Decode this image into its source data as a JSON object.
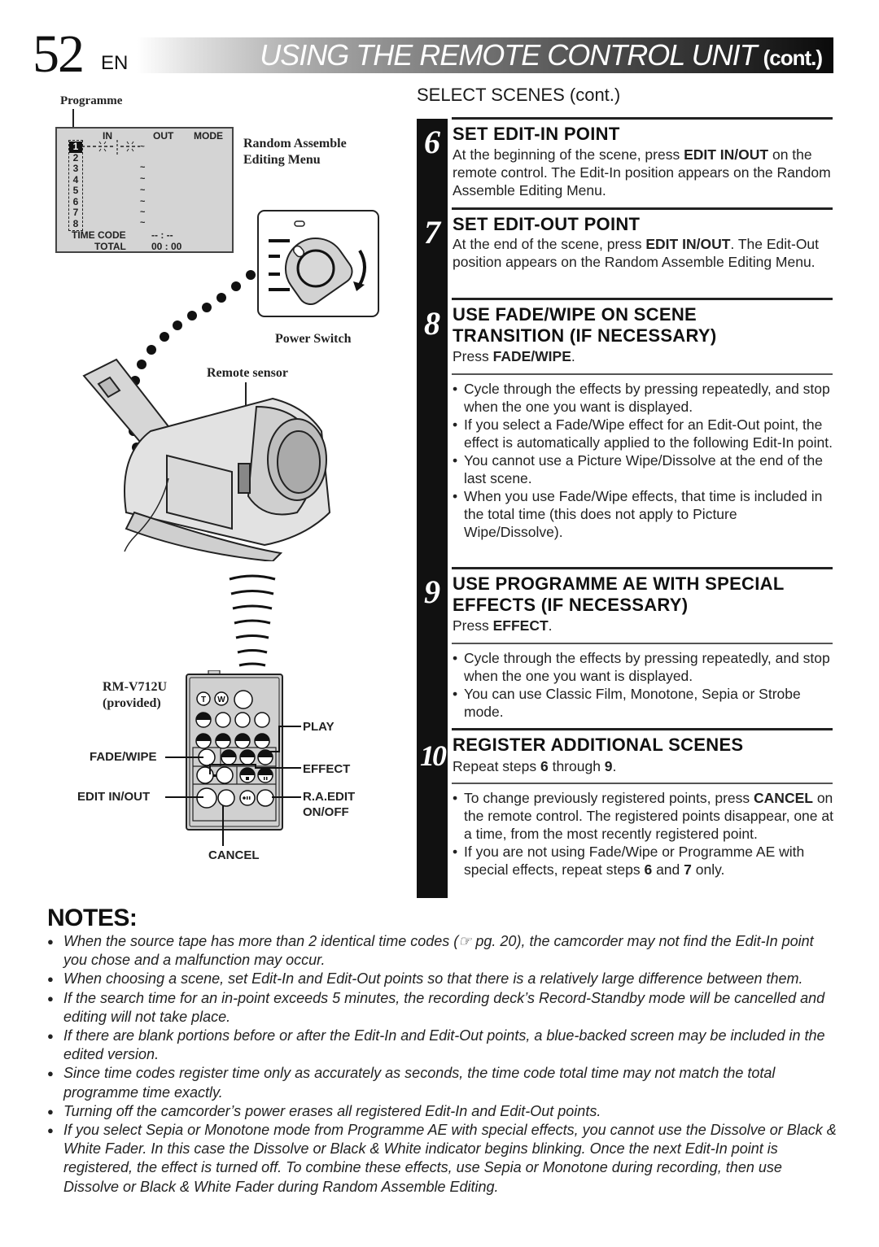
{
  "header": {
    "page_number": "52",
    "language": "EN",
    "title": "USING THE REMOTE CONTROL UNIT",
    "title_suffix": "(cont.)"
  },
  "illustration": {
    "programme_label": "Programme",
    "menu_caption_line1": "Random Assemble",
    "menu_caption_line2": "Editing Menu",
    "menu": {
      "col_in": "IN",
      "col_out": "OUT",
      "col_mode": "MODE",
      "rows": [
        "1",
        "2",
        "3",
        "4",
        "5",
        "6",
        "7",
        "8"
      ],
      "time_code_label": "TIME CODE",
      "time_code_value": "-- : --",
      "total_label": "TOTAL",
      "total_value": "00 : 00"
    },
    "power_switch_label": "Power Switch",
    "remote_sensor_label": "Remote sensor",
    "remote_model": "RM-V712U",
    "remote_model_note": "(provided)",
    "remote_button_T": "T",
    "remote_button_W": "W",
    "callouts": {
      "play": "PLAY",
      "fade_wipe": "FADE/WIPE",
      "effect": "EFFECT",
      "edit_in_out": "EDIT IN/OUT",
      "ra_edit_line1": "R.A.EDIT",
      "ra_edit_line2": "ON/OFF",
      "cancel": "CANCEL"
    }
  },
  "section": {
    "title": "SELECT SCENES (cont.)",
    "steps": [
      {
        "number": "6",
        "heading": "SET EDIT-IN POINT",
        "body_pre": "At the beginning of the scene, press ",
        "body_bold": "EDIT IN/OUT",
        "body_post": " on the remote control. The Edit-In position appears on the Random Assemble Editing Menu."
      },
      {
        "number": "7",
        "heading": "SET EDIT-OUT POINT",
        "body_pre": "At the end of the scene, press ",
        "body_bold": "EDIT IN/OUT",
        "body_post": ". The Edit-Out position appears on the Random Assemble Editing Menu."
      },
      {
        "number": "8",
        "heading_line1": "USE FADE/WIPE ON SCENE",
        "heading_line2": "TRANSITION (IF NECESSARY)",
        "body_pre": "Press ",
        "body_bold": "FADE/WIPE",
        "body_post": ".",
        "bullets": [
          "Cycle through the effects by pressing repeatedly, and stop when the one you want is displayed.",
          "If you select a Fade/Wipe effect for an Edit-Out point, the effect is automatically applied to the following Edit-In point.",
          "You cannot use a Picture Wipe/Dissolve at the end of the last scene.",
          "When you use Fade/Wipe effects, that time is included in the total time (this does not apply to Picture Wipe/Dissolve)."
        ]
      },
      {
        "number": "9",
        "heading_line1": "USE PROGRAMME AE WITH SPECIAL",
        "heading_line2": "EFFECTS (IF NECESSARY)",
        "body_pre": "Press ",
        "body_bold": "EFFECT",
        "body_post": ".",
        "bullets": [
          "Cycle through the effects by pressing repeatedly, and stop when the one you want is displayed.",
          "You can use Classic Film, Monotone, Sepia or Strobe mode."
        ]
      },
      {
        "number": "10",
        "heading": "REGISTER ADDITIONAL SCENES",
        "body_pre": "Repeat steps ",
        "body_bold1": "6",
        "body_mid": " through ",
        "body_bold2": "9",
        "body_post": ".",
        "bullet1_pre": "To change previously registered points, press ",
        "bullet1_bold": "CANCEL",
        "bullet1_post": " on the remote control. The registered points disappear, one at a time, from the most recently registered point.",
        "bullet2_pre": "If you are not using Fade/Wipe or Programme AE with special effects, repeat steps ",
        "bullet2_bold1": "6",
        "bullet2_mid": " and ",
        "bullet2_bold2": "7",
        "bullet2_post": " only."
      }
    ]
  },
  "notes": {
    "title": "NOTES:",
    "items": [
      "When the source tape has more than 2 identical time codes (☞ pg. 20), the camcorder may not find the Edit-In point you chose and a malfunction may occur.",
      "When choosing a scene, set Edit-In and Edit-Out points so that there is a relatively large difference between them.",
      "If the search time for an in-point exceeds 5 minutes, the recording deck’s Record-Standby mode will be cancelled and editing will not take place.",
      "If there are blank portions before or after the Edit-In and Edit-Out points, a blue-backed screen may be included in the edited version.",
      "Since time codes register time only as accurately as seconds, the time code total time may not match the total programme time exactly.",
      "Turning off the camcorder’s power erases all registered  Edit-In and Edit-Out points.",
      "If you select Sepia or Monotone mode from Programme AE with special effects, you cannot use the Dissolve or Black & White Fader. In this case the Dissolve or Black & White indicator begins blinking. Once the next Edit-In point is registered, the effect is turned off. To combine these effects, use Sepia or Monotone during recording, then use Dissolve or Black & White Fader during Random Assemble Editing."
    ]
  }
}
